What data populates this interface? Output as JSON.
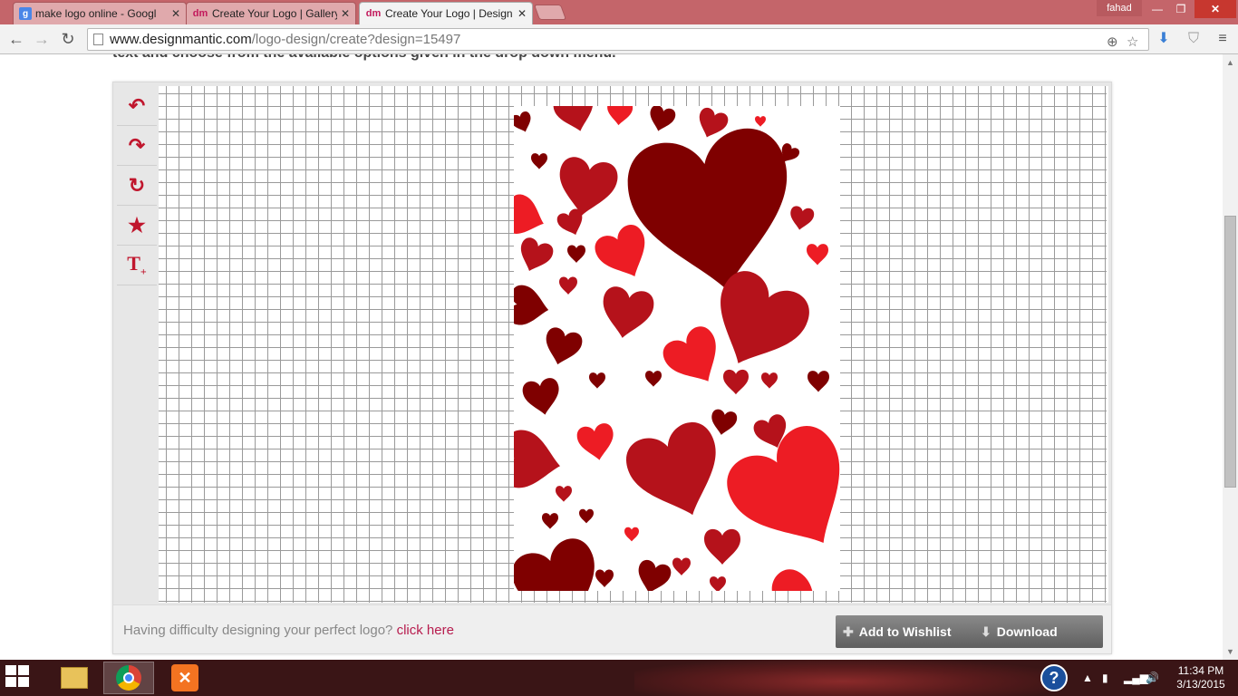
{
  "browser": {
    "tabs": [
      {
        "title": "make logo online - Googl",
        "favicon": "google-icon",
        "active": false
      },
      {
        "title": "Create Your Logo | Gallery",
        "favicon": "dm-icon",
        "active": false
      },
      {
        "title": "Create Your Logo | Design",
        "favicon": "dm-icon",
        "active": true
      }
    ],
    "user": "fahad",
    "url_host": "www.designmantic.com",
    "url_path": "/logo-design/create?design=15497",
    "favicon_text": "dm"
  },
  "page": {
    "cut_off_text": "text and choose from the available options given in the drop down menu.",
    "tools": [
      "undo",
      "redo",
      "reset",
      "add-symbol",
      "add-text"
    ],
    "help_text": "Having difficulty designing your perfect logo?",
    "help_link": "click here",
    "wishlist_button": "Add to Wishlist",
    "download_button": "Download"
  },
  "taskbar": {
    "time": "11:34 PM",
    "date": "3/13/2015"
  },
  "colors": {
    "heart_dark": "#7f0000",
    "heart_mid": "#b5121b",
    "heart_bright": "#ed1c24",
    "accent": "#c0162d"
  }
}
